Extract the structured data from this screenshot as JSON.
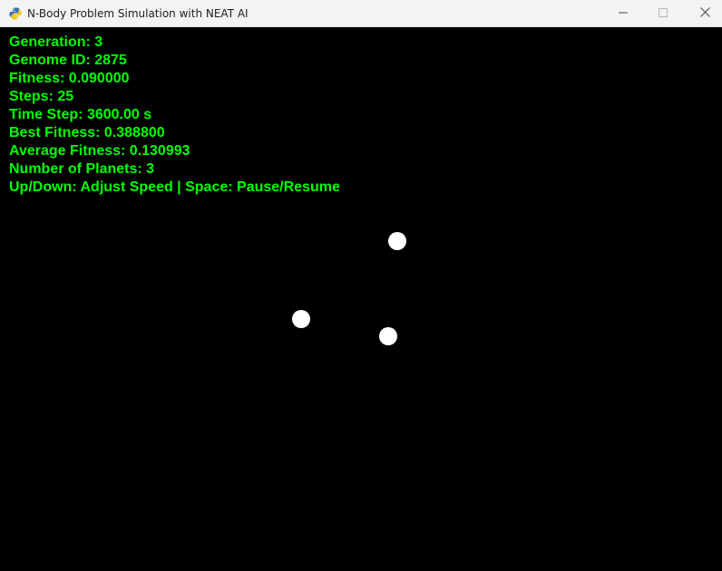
{
  "window": {
    "title": "N-Body Problem Simulation with NEAT AI",
    "icon": "pygame-snake-icon",
    "controls": [
      "minimize-icon",
      "maximize-icon",
      "close-icon"
    ]
  },
  "hud": {
    "color": "#00ff00",
    "lines": [
      "Generation: 3",
      "Genome ID: 2875",
      "Fitness: 0.090000",
      "Steps: 25",
      "Time Step: 3600.00 s",
      "Best Fitness: 0.388800",
      "Average Fitness: 0.130993",
      "Number of Planets: 3",
      "Up/Down: Adjust Speed | Space: Pause/Resume"
    ]
  },
  "simulation": {
    "background": "#000000",
    "planet_color": "#ffffff",
    "planet_count": 3
  }
}
